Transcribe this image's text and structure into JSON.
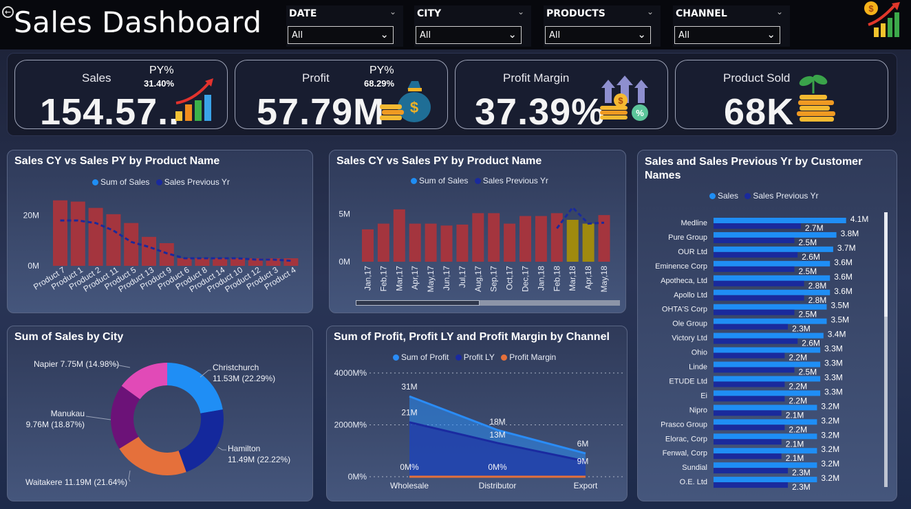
{
  "header": {
    "title": "Sales Dashboard",
    "slicers": [
      {
        "label": "DATE",
        "value": "All"
      },
      {
        "label": "CITY",
        "value": "All"
      },
      {
        "label": "PRODUCTS",
        "value": "All"
      },
      {
        "label": "CHANNEL",
        "value": "All"
      }
    ],
    "icons": {
      "back": "back-arrow-icon",
      "logo": "money-growth-chart-icon",
      "chevron": "chevron-down-icon"
    }
  },
  "kpis": {
    "sales": {
      "title": "Sales",
      "value": "154.57..",
      "py_label": "PY%",
      "py_value": "31.40%",
      "icon": "bar-chart-growth-icon"
    },
    "profit": {
      "title": "Profit",
      "value": "57.79M",
      "py_label": "PY%",
      "py_value": "68.29%",
      "icon": "money-bag-icon"
    },
    "margin": {
      "title": "Profit Margin",
      "value": "37.39%",
      "icon": "coins-percent-icon"
    },
    "sold": {
      "title": "Product Sold",
      "value": "68K",
      "icon": "plant-coins-icon"
    }
  },
  "colors": {
    "bar_red": "#a4353e",
    "bar_highlight": "#a08a0e",
    "line_dark": "#1a2a9c",
    "bar_blue": "#1f8ef5",
    "bar_navy": "#1a2a9c",
    "pie": [
      "#1f8ef5",
      "#14289c",
      "#e5703b",
      "#6c1278",
      "#e14ab7"
    ],
    "area_light": "#2a8cf6",
    "area_dark": "#1a2aa0",
    "margin_line": "#e5703b"
  },
  "chart_data": [
    {
      "type": "bar",
      "title": "Sales CY vs Sales PY by Product Name",
      "legend": [
        "Sum of Sales",
        "Sales Previous Yr"
      ],
      "legend_position": "top",
      "categories": [
        "Product 7",
        "Product 1",
        "Product 2",
        "Product 11",
        "Product 5",
        "Product 13",
        "Product 9",
        "Product 6",
        "Product 8",
        "Product 14",
        "Product 10",
        "Product 12",
        "Product 3",
        "Product 4"
      ],
      "series": [
        {
          "name": "Sum of Sales",
          "kind": "bar",
          "values": [
            26,
            25.5,
            23,
            20.5,
            17,
            11.5,
            9,
            3,
            3,
            3,
            3,
            3,
            3,
            3
          ]
        },
        {
          "name": "Sales Previous Yr",
          "kind": "line",
          "values": [
            18,
            18,
            17,
            14,
            9.5,
            7.5,
            5,
            3,
            3,
            3,
            3,
            2.5,
            2.5,
            2
          ]
        }
      ],
      "yticks": [
        "0M",
        "20M"
      ],
      "ylim": [
        0,
        30
      ]
    },
    {
      "type": "bar",
      "title": "Sales CY vs Sales PY by Product Name",
      "legend": [
        "Sum of Sales",
        "Sales Previous Yr"
      ],
      "legend_position": "top",
      "categories": [
        "Jan,17",
        "Feb,17",
        "Mar,17",
        "Apr,17",
        "May,17",
        "Jun,17",
        "Jul,17",
        "Aug,17",
        "Sep,17",
        "Oct,17",
        "Dec,17",
        "Jan,18",
        "Feb,18",
        "Mar,18",
        "Apr,18",
        "May,18"
      ],
      "series": [
        {
          "name": "Sum of Sales",
          "kind": "bar",
          "values": [
            3.4,
            4.0,
            5.5,
            4.0,
            4.0,
            3.8,
            3.9,
            5.1,
            5.1,
            4.0,
            4.8,
            4.8,
            5.1,
            4.4,
            4.0,
            4.9
          ]
        },
        {
          "name": "Sales Previous Yr",
          "kind": "line",
          "values": [
            null,
            null,
            null,
            null,
            null,
            null,
            null,
            null,
            null,
            null,
            null,
            null,
            3.5,
            5.7,
            4.0,
            4.1
          ]
        }
      ],
      "highlighted": [
        "Mar,18",
        "Apr,18"
      ],
      "yticks": [
        "0M",
        "5M"
      ],
      "ylim": [
        0,
        7
      ]
    },
    {
      "type": "pie",
      "title": "Sum of Sales by City",
      "slices": [
        {
          "label": "Christchurch",
          "text": "11.53M (22.29%)",
          "value": 22.29
        },
        {
          "label": "Hamilton",
          "text": "11.49M (22.22%)",
          "value": 22.22
        },
        {
          "label": "Waitakere",
          "text": "11.19M (21.64%)",
          "value": 21.64
        },
        {
          "label": "Manukau",
          "text": "9.76M (18.87%)",
          "value": 18.87
        },
        {
          "label": "Napier",
          "text": "7.75M (14.98%)",
          "value": 14.98
        }
      ]
    },
    {
      "type": "area",
      "title": "Sum of Profit, Profit LY and Profit Margin by Channel",
      "legend": [
        "Sum of Profit",
        "Profit LY",
        "Profit Margin"
      ],
      "legend_position": "top",
      "categories": [
        "Wholesale",
        "Distributor",
        "Export"
      ],
      "series": [
        {
          "name": "Sum of Profit",
          "values": [
            31,
            18,
            9
          ],
          "labels": [
            "31M",
            "18M",
            "9M"
          ]
        },
        {
          "name": "Profit LY",
          "values": [
            21,
            13,
            6
          ],
          "labels": [
            "21M",
            "13M",
            "6M"
          ]
        },
        {
          "name": "Profit Margin",
          "values": [
            0,
            0,
            0
          ],
          "labels": [
            "0M%",
            "0M%",
            ""
          ]
        }
      ],
      "yticks": [
        "0M%",
        "2000M%",
        "4000M%"
      ]
    },
    {
      "type": "bar",
      "orientation": "horizontal",
      "title": "Sales and Sales Previous Yr by Customer Names",
      "legend": [
        "Sales",
        "Sales Previous Yr"
      ],
      "legend_position": "top",
      "categories": [
        "Medline",
        "Pure Group",
        "OUR Ltd",
        "Eminence Corp",
        "Apotheca, Ltd",
        "Apollo Ltd",
        "OHTA'S Corp",
        "Ole Group",
        "Victory Ltd",
        "Ohio",
        "Linde",
        "ETUDE Ltd",
        "Ei",
        "Nipro",
        "Prasco Group",
        "Elorac, Corp",
        "Fenwal, Corp",
        "Sundial",
        "O.E. Ltd"
      ],
      "series": [
        {
          "name": "Sales",
          "values": [
            4.1,
            3.8,
            3.7,
            3.6,
            3.6,
            3.6,
            3.5,
            3.5,
            3.4,
            3.3,
            3.3,
            3.3,
            3.3,
            3.2,
            3.2,
            3.2,
            3.2,
            3.2,
            3.2
          ],
          "labels": [
            "4.1M",
            "3.8M",
            "3.7M",
            "3.6M",
            "3.6M",
            "3.6M",
            "3.5M",
            "3.5M",
            "3.4M",
            "3.3M",
            "3.3M",
            "3.3M",
            "3.3M",
            "3.2M",
            "3.2M",
            "3.2M",
            "3.2M",
            "3.2M",
            "3.2M"
          ]
        },
        {
          "name": "Sales Previous Yr",
          "values": [
            2.7,
            2.5,
            2.6,
            2.5,
            2.8,
            2.8,
            2.5,
            2.3,
            2.6,
            2.2,
            2.5,
            2.2,
            2.2,
            2.1,
            2.2,
            2.1,
            2.1,
            2.3,
            2.3
          ],
          "labels": [
            "2.7M",
            "2.5M",
            "2.6M",
            "2.5M",
            "2.8M",
            "2.8M",
            "2.5M",
            "2.3M",
            "2.6M",
            "2.2M",
            "2.5M",
            "2.2M",
            "2.2M",
            "2.1M",
            "2.2M",
            "2.1M",
            "2.1M",
            "2.3M",
            "2.3M"
          ]
        }
      ]
    }
  ]
}
